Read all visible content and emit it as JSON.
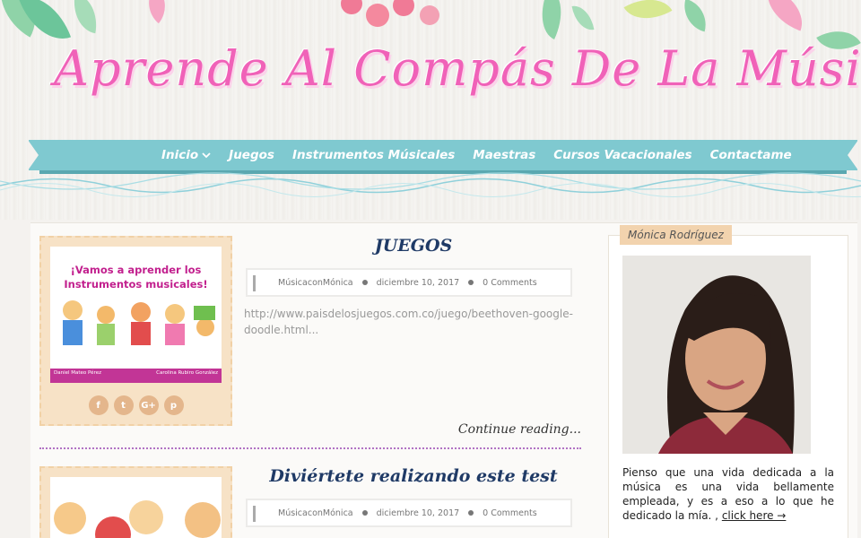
{
  "site": {
    "title": "Aprende Al Compás De La Música"
  },
  "nav": {
    "items": [
      {
        "label": "Inicio",
        "has_dropdown": true
      },
      {
        "label": "Juegos"
      },
      {
        "label": "Instrumentos Músicales"
      },
      {
        "label": "Maestras"
      },
      {
        "label": "Cursos Vacacionales"
      },
      {
        "label": "Contactame"
      }
    ]
  },
  "posts": [
    {
      "title": "JUEGOS",
      "author": "MúsicaconMónica",
      "date": "diciembre 10, 2017",
      "comments": "0 Comments",
      "excerpt": "http://www.paisdelosjuegos.com.co/juego/beethoven-google-doodle.html...",
      "continue_label": "Continue reading...",
      "thumb_caption_line1": "¡Vamos a aprender los",
      "thumb_caption_line2": "Instrumentos musicales!",
      "thumb_footer_left": "Daniel Mateo Pérez",
      "thumb_footer_right": "Carolina Rubiro González"
    },
    {
      "title": "Diviértete realizando este test",
      "author": "MúsicaconMónica",
      "date": "diciembre 10, 2017",
      "comments": "0 Comments"
    }
  ],
  "sidebar": {
    "widget_title": "Mónica Rodríguez",
    "bio": "Pienso que una vida dedicada a la música es una vida bellamente empleada, y es a eso a lo que he dedicado la mía. ,",
    "link_label": "click here →"
  },
  "colors": {
    "title_pink": "#f062b8",
    "nav_teal": "#7fc9d0",
    "post_title_navy": "#1f3a66",
    "thumb_bg": "#f7e2c6",
    "divider_purple": "#b173c4"
  }
}
